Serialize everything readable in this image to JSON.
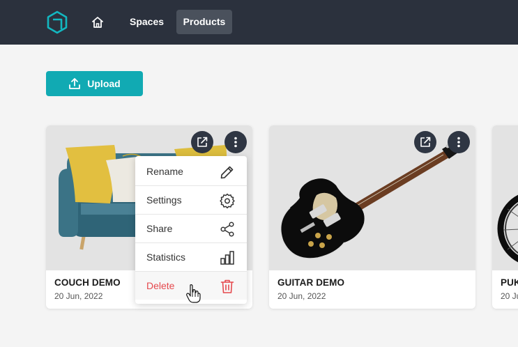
{
  "nav": {
    "spaces_label": "Spaces",
    "products_label": "Products"
  },
  "toolbar": {
    "upload_label": "Upload"
  },
  "cards": [
    {
      "title": "COUCH DEMO",
      "date": "20 Jun, 2022"
    },
    {
      "title": "GUITAR DEMO",
      "date": "20 Jun, 2022"
    },
    {
      "title": "PUKE",
      "date": "20 Ju"
    }
  ],
  "context_menu": {
    "items": [
      {
        "label": "Rename",
        "icon": "pencil-icon"
      },
      {
        "label": "Settings",
        "icon": "gear-icon"
      },
      {
        "label": "Share",
        "icon": "share-icon"
      },
      {
        "label": "Statistics",
        "icon": "bar-chart-icon"
      },
      {
        "label": "Delete",
        "icon": "trash-icon"
      }
    ]
  },
  "colors": {
    "topbar": "#2b313d",
    "accent": "#11aab3",
    "danger": "#e5484d"
  }
}
